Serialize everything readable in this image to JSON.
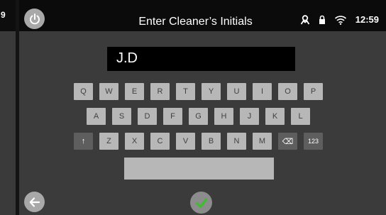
{
  "left_panel": {
    "clock_fragment": "9"
  },
  "header": {
    "title": "Enter Cleaner’s Initials",
    "time": "12:59"
  },
  "input": {
    "value": "J.D"
  },
  "keyboard": {
    "row1": [
      "Q",
      "W",
      "E",
      "R",
      "T",
      "Y",
      "U",
      "I",
      "O",
      "P"
    ],
    "row2": [
      "A",
      "S",
      "D",
      "F",
      "G",
      "H",
      "J",
      "K",
      "L"
    ],
    "row3": [
      "Z",
      "X",
      "C",
      "V",
      "B",
      "N",
      "M"
    ],
    "shift_symbol": "↑",
    "backspace_symbol": "⌫",
    "numbers_label": "123"
  },
  "icons": {
    "power": "power-icon",
    "user": "user-icon",
    "lock": "lock-icon",
    "wifi": "wifi-icon",
    "back": "arrow-left-icon",
    "confirm": "checkmark-icon"
  },
  "colors": {
    "confirm_check": "#3cbf2c"
  }
}
